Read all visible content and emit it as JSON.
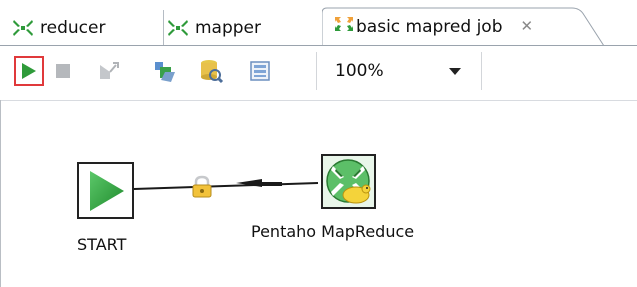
{
  "tabs": [
    {
      "label": "reducer",
      "icon": "transformation-icon"
    },
    {
      "label": "mapper",
      "icon": "transformation-icon"
    },
    {
      "label": "basic mapred job",
      "icon": "job-icon",
      "active": true,
      "close_icon": "close-icon"
    }
  ],
  "toolbar": {
    "buttons": [
      "run-icon",
      "stop-icon",
      "cancel-icon",
      "sql-icon",
      "database-explore-icon",
      "layout-icon"
    ],
    "zoom": {
      "value": "100%"
    }
  },
  "canvas": {
    "entries": [
      {
        "label": "START",
        "icon": "start-icon"
      },
      {
        "label": "Pentaho MapReduce",
        "icon": "pentaho-mapreduce-icon"
      }
    ],
    "hop": {
      "icon": "lock-icon"
    }
  },
  "colors": {
    "run_green": "#2f9b3a",
    "run_border": "#e0393b",
    "tab_icon_green": "#2e9a3a",
    "job_icon_orange": "#f0a13a"
  }
}
